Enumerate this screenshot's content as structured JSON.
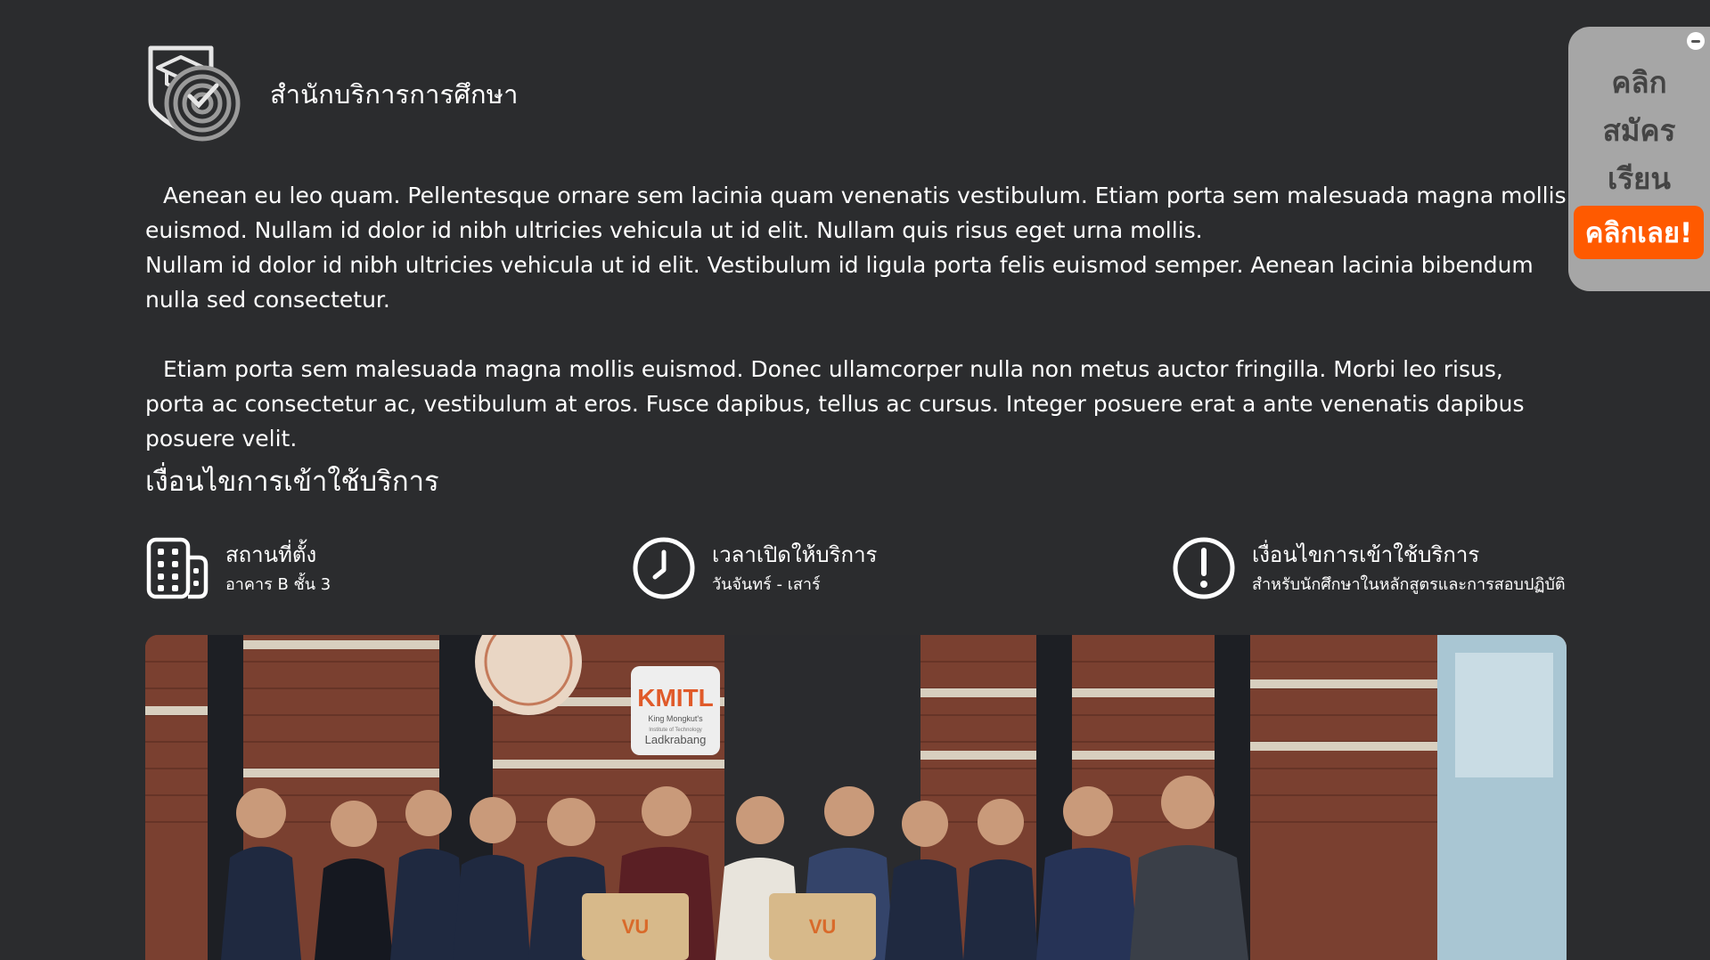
{
  "header": {
    "org_title": "สำนักบริการการศึกษา",
    "logo_icon": "graduation-cap-shield-logo"
  },
  "intro": {
    "p1": "Aenean eu leo quam. Pellentesque ornare sem lacinia quam venenatis vestibulum. Etiam porta sem malesuada magna mollis euismod. Nullam id dolor id nibh ultricies vehicula ut id elit. Nullam quis risus eget urna mollis.",
    "p2": "Nullam id dolor id nibh ultricies vehicula ut id elit. Vestibulum id ligula porta felis euismod semper. Aenean lacinia bibendum nulla sed consectetur.",
    "p3": "Etiam porta sem malesuada magna mollis euismod. Donec ullamcorper nulla non metus auctor fringilla. Morbi leo risus, porta ac consectetur ac, vestibulum at eros. Fusce dapibus, tellus ac cursus. Integer posuere erat a ante venenatis dapibus posuere velit."
  },
  "conditions": {
    "section_title": "เงื่อนไขการเข้าใช้บริการ",
    "items": [
      {
        "icon": "building-icon",
        "title": "สถานที่ตั้ง",
        "desc": "อาคาร B ชั้น 3"
      },
      {
        "icon": "clock-icon",
        "title": "เวลาเปิดให้บริการ",
        "desc": "วันจันทร์ - เสาร์"
      },
      {
        "icon": "exclamation-circle-icon",
        "title": "เงื่อนไขการเข้าใช้บริการ",
        "desc": "สำหรับนักศึกษาในหลักสูตรและการสอบปฏิบัติ"
      }
    ]
  },
  "photo": {
    "sign_brand": "KMITL",
    "sign_line1": "King Mongkut's",
    "sign_line2": "Institute of Technology",
    "sign_line3": "Ladkrabang",
    "bag_logo": "VU"
  },
  "apply_widget": {
    "line1": "คลิก",
    "line2": "สมัคร",
    "line3": "เรียน",
    "button_label": "คลิกเลย!",
    "accent_color": "#ff5a00",
    "panel_color": "#a6a6a6",
    "close_icon": "minus-circle-icon"
  },
  "theme": {
    "background": "#2b2c2e",
    "text": "#ffffff"
  }
}
